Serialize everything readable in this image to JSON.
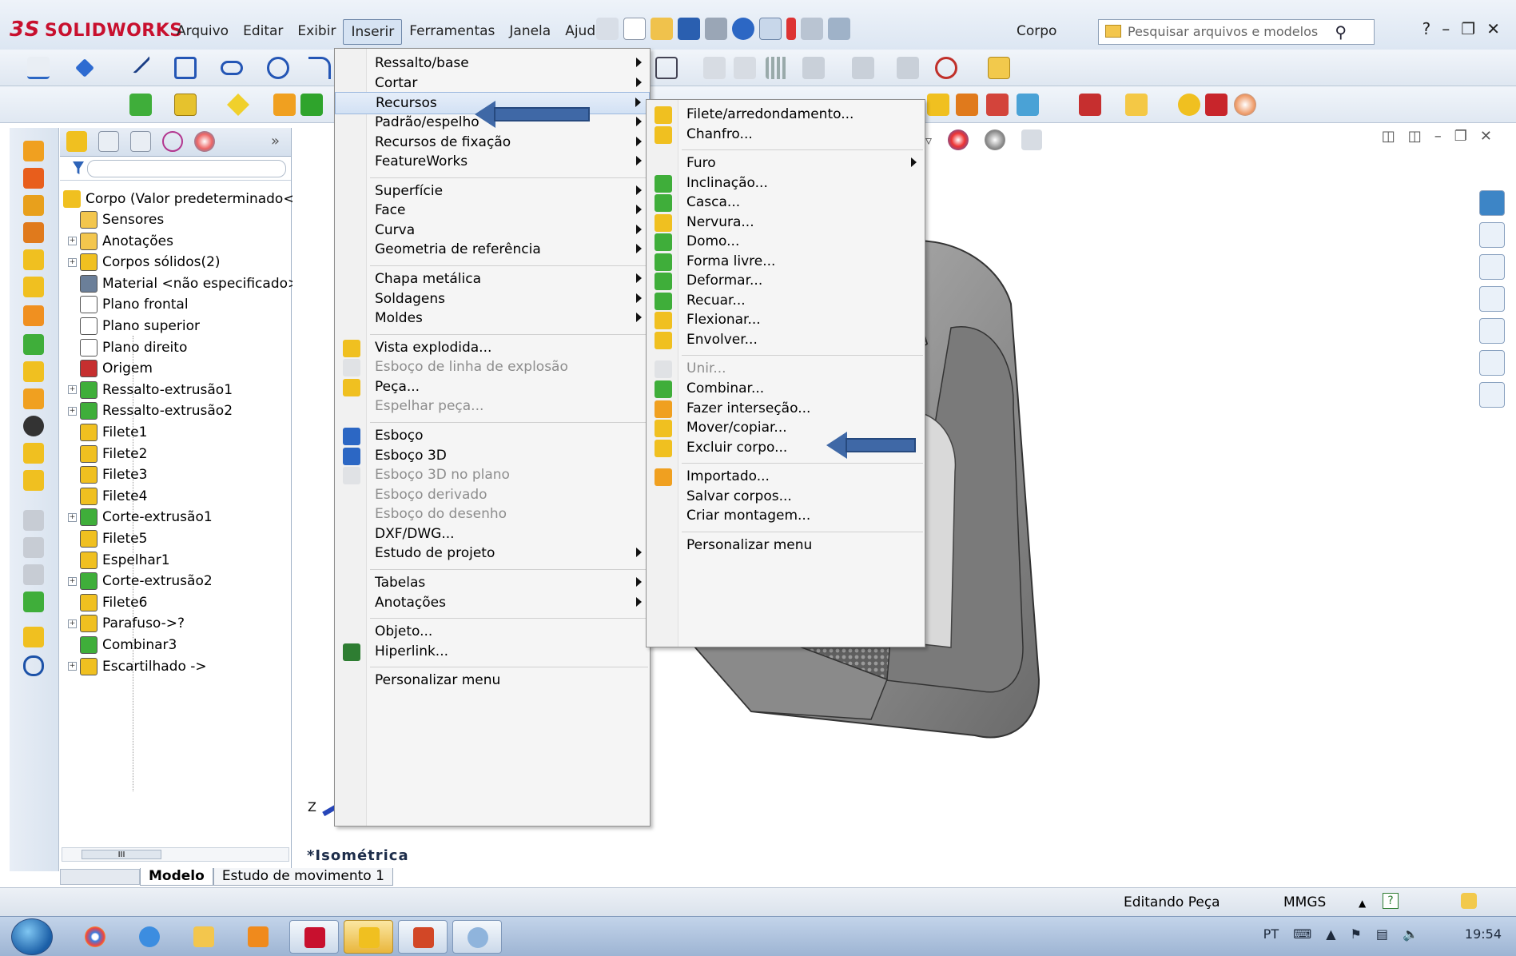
{
  "app": {
    "brand": "SOLIDWORKS",
    "brand_prefix": "3S",
    "document_title": "Corpo"
  },
  "menubar": [
    "Arquivo",
    "Editar",
    "Exibir",
    "Inserir",
    "Ferramentas",
    "Janela",
    "Ajuda"
  ],
  "search": {
    "placeholder": "Pesquisar arquivos e modelos"
  },
  "feature_tree": {
    "root": "Corpo  (Valor predeterminado<<",
    "items": [
      {
        "label": "Sensores",
        "expandable": false
      },
      {
        "label": "Anotações",
        "expandable": true
      },
      {
        "label": "Corpos sólidos(2)",
        "expandable": true
      },
      {
        "label": "Material <não especificado>",
        "expandable": false
      },
      {
        "label": "Plano frontal",
        "expandable": false
      },
      {
        "label": "Plano superior",
        "expandable": false
      },
      {
        "label": "Plano direito",
        "expandable": false
      },
      {
        "label": "Origem",
        "expandable": false
      },
      {
        "label": "Ressalto-extrusão1",
        "expandable": true
      },
      {
        "label": "Ressalto-extrusão2",
        "expandable": true
      },
      {
        "label": "Filete1",
        "expandable": false
      },
      {
        "label": "Filete2",
        "expandable": false
      },
      {
        "label": "Filete3",
        "expandable": false
      },
      {
        "label": "Filete4",
        "expandable": false
      },
      {
        "label": "Corte-extrusão1",
        "expandable": true
      },
      {
        "label": "Filete5",
        "expandable": false
      },
      {
        "label": "Espelhar1",
        "expandable": false
      },
      {
        "label": "Corte-extrusão2",
        "expandable": true
      },
      {
        "label": "Filete6",
        "expandable": false
      },
      {
        "label": "Parafuso->?",
        "expandable": true
      },
      {
        "label": "Combinar3",
        "expandable": false
      },
      {
        "label": "Escartilhado ->",
        "expandable": true
      }
    ],
    "scroll_label": "III"
  },
  "insert_menu": [
    {
      "label": "Ressalto/base",
      "submenu": true
    },
    {
      "label": "Cortar",
      "submenu": true
    },
    {
      "label": "Recursos",
      "submenu": true,
      "highlighted": true
    },
    {
      "label": "Padrão/espelho",
      "submenu": true
    },
    {
      "label": "Recursos de fixação",
      "submenu": true
    },
    {
      "label": "FeatureWorks",
      "submenu": true
    },
    {
      "label": "Superfície",
      "submenu": true
    },
    {
      "label": "Face",
      "submenu": true
    },
    {
      "label": "Curva",
      "submenu": true
    },
    {
      "label": "Geometria de referência",
      "submenu": true
    },
    {
      "label": "Chapa metálica",
      "submenu": true
    },
    {
      "label": "Soldagens",
      "submenu": true
    },
    {
      "label": "Moldes",
      "submenu": true
    },
    {
      "label": "Vista explodida...",
      "submenu": false
    },
    {
      "label": "Esboço de linha de explosão",
      "submenu": false,
      "disabled": true
    },
    {
      "label": "Peça...",
      "submenu": false
    },
    {
      "label": "Espelhar peça...",
      "submenu": false,
      "disabled": true
    },
    {
      "label": "Esboço",
      "submenu": false
    },
    {
      "label": "Esboço 3D",
      "submenu": false
    },
    {
      "label": "Esboço 3D no plano",
      "submenu": false,
      "disabled": true
    },
    {
      "label": "Esboço derivado",
      "submenu": false,
      "disabled": true
    },
    {
      "label": "Esboço do desenho",
      "submenu": false,
      "disabled": true
    },
    {
      "label": "DXF/DWG...",
      "submenu": false
    },
    {
      "label": "Estudo de projeto",
      "submenu": true
    },
    {
      "label": "Tabelas",
      "submenu": true
    },
    {
      "label": "Anotações",
      "submenu": true
    },
    {
      "label": "Objeto...",
      "submenu": false
    },
    {
      "label": "Hiperlink...",
      "submenu": false
    },
    {
      "label": "Personalizar menu",
      "submenu": false
    }
  ],
  "features_submenu": [
    {
      "label": "Filete/arredondamento...",
      "submenu": false
    },
    {
      "label": "Chanfro...",
      "submenu": false
    },
    {
      "label": "Furo",
      "submenu": true
    },
    {
      "label": "Inclinação...",
      "submenu": false
    },
    {
      "label": "Casca...",
      "submenu": false
    },
    {
      "label": "Nervura...",
      "submenu": false
    },
    {
      "label": "Domo...",
      "submenu": false
    },
    {
      "label": "Forma livre...",
      "submenu": false
    },
    {
      "label": "Deformar...",
      "submenu": false
    },
    {
      "label": "Recuar...",
      "submenu": false
    },
    {
      "label": "Flexionar...",
      "submenu": false
    },
    {
      "label": "Envolver...",
      "submenu": false
    },
    {
      "label": "Unir...",
      "submenu": false,
      "disabled": true
    },
    {
      "label": "Combinar...",
      "submenu": false
    },
    {
      "label": "Fazer interseção...",
      "submenu": false
    },
    {
      "label": "Mover/copiar...",
      "submenu": false
    },
    {
      "label": "Excluir corpo...",
      "submenu": false
    },
    {
      "label": "Importado...",
      "submenu": false
    },
    {
      "label": "Salvar corpos...",
      "submenu": false
    },
    {
      "label": "Criar montagem...",
      "submenu": false
    },
    {
      "label": "Personalizar menu",
      "submenu": false
    }
  ],
  "viewport": {
    "view_name": "*Isométrica",
    "triad_label": "Z"
  },
  "bottom_tabs": [
    "Modelo",
    "Estudo de movimento 1"
  ],
  "statusbar": {
    "mode": "Editando Peça",
    "units": "MMGS",
    "help": "?"
  },
  "taskbar": {
    "language": "PT",
    "time": "19:54"
  },
  "colors": {
    "accent": "#3f68a6",
    "menu_highlight": "#d2e1f4",
    "brand_red": "#c8102e"
  }
}
